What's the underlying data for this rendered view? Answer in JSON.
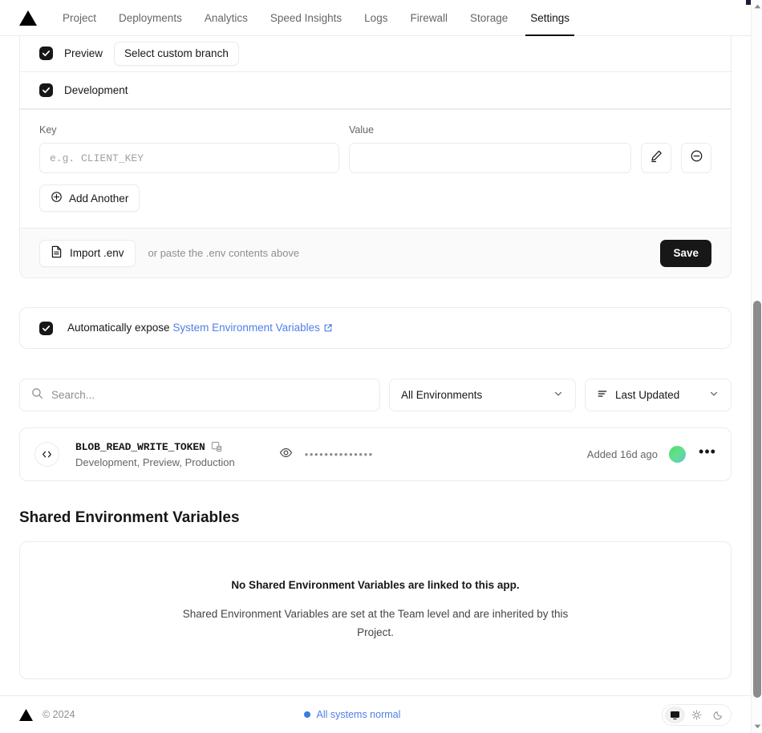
{
  "nav": {
    "logo_icon": "vercel-triangle-logo",
    "tabs": [
      {
        "label": "Project",
        "active": false
      },
      {
        "label": "Deployments",
        "active": false
      },
      {
        "label": "Analytics",
        "active": false
      },
      {
        "label": "Speed Insights",
        "active": false
      },
      {
        "label": "Logs",
        "active": false
      },
      {
        "label": "Firewall",
        "active": false
      },
      {
        "label": "Storage",
        "active": false
      },
      {
        "label": "Settings",
        "active": true
      }
    ]
  },
  "env_targets": {
    "preview": {
      "label": "Preview",
      "checked": true,
      "branch_button": "Select custom branch"
    },
    "development": {
      "label": "Development",
      "checked": true
    }
  },
  "kv_form": {
    "key_header": "Key",
    "value_header": "Value",
    "key_placeholder": "e.g. CLIENT_KEY",
    "key_value": "",
    "value_placeholder": "",
    "value_value": "",
    "edit_icon": "pencil-icon",
    "remove_icon": "minus-circle-icon",
    "add_another_label": "Add Another",
    "add_icon": "plus-circle-icon"
  },
  "import_bar": {
    "import_label": "Import .env",
    "import_icon": "document-icon",
    "hint": "or paste the .env contents above",
    "save_label": "Save"
  },
  "auto_expose": {
    "checked": true,
    "text": "Automatically expose",
    "link": "System Environment Variables",
    "external_icon": "external-link-icon",
    "link_color": "#4f7fe8"
  },
  "filters": {
    "search_placeholder": "Search...",
    "search_value": "",
    "search_icon": "search-icon",
    "environment_select": "All Environments",
    "sort_select": "Last Updated",
    "sort_icon": "sort-lines-icon",
    "chevron_icon": "chevron-down-icon"
  },
  "variables": [
    {
      "key": "BLOB_READ_WRITE_TOKEN",
      "type_icon": "code-brackets-icon",
      "source_icon": "blob-store-icon",
      "environments": "Development, Preview, Production",
      "reveal_icon": "eye-icon",
      "masked_value": "••••••••••••••",
      "added": "Added 16d ago",
      "avatar": "user-avatar",
      "avatar_color": "#4ade5f",
      "menu_icon": "ellipsis-icon"
    }
  ],
  "shared_section": {
    "title": "Shared Environment Variables",
    "empty_heading": "No Shared Environment Variables are linked to this app.",
    "empty_body": "Shared Environment Variables are set at the Team level and are inherited by this Project."
  },
  "footer": {
    "logo_icon": "vercel-triangle-logo",
    "copyright": "© 2024",
    "status_text": "All systems normal",
    "status_color": "#3b7ddd",
    "theme_options": [
      {
        "icon": "monitor-icon",
        "active": true
      },
      {
        "icon": "sun-icon",
        "active": false
      },
      {
        "icon": "moon-icon",
        "active": false
      }
    ]
  },
  "scrollbar": {
    "up_icon": "caret-up-icon",
    "down_icon": "caret-down-icon"
  }
}
